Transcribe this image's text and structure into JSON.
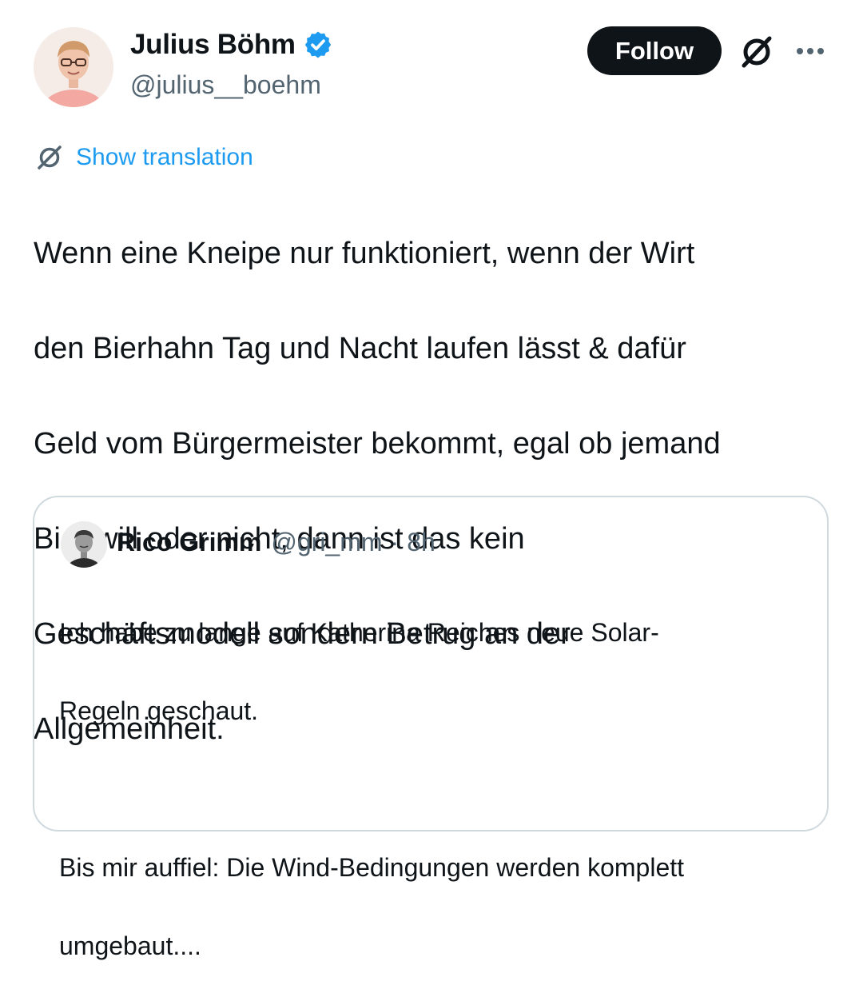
{
  "post": {
    "author_name": "Julius Böhm",
    "author_handle": "@julius__boehm",
    "follow_label": "Follow",
    "translate_label": "Show translation",
    "text_lines": [
      "Wenn eine Kneipe nur funktioniert, wenn der Wirt",
      "den Bierhahn Tag und Nacht laufen lässt & dafür",
      "Geld vom Bürgermeister bekommt, egal ob jemand",
      "Bier will oder nicht, dann ist das kein",
      "Geschäftsmodell sondern Betrug an der",
      "Allgemeinheit."
    ]
  },
  "quote": {
    "author_name": "Rico Grimm",
    "author_handle": "@gri_mm",
    "separator": "·",
    "time": "8h",
    "text_lines": [
      "Ich habe zu lange auf Katherina Reiches neue Solar-",
      "Regeln geschaut.",
      "",
      "Bis mir auffiel: Die Wind-Bedingungen werden komplett",
      "umgebaut...."
    ]
  },
  "icons": {
    "verified": "verified-badge-icon",
    "grok": "grok-icon",
    "more": "more-dots-icon",
    "translate": "grok-translate-icon"
  },
  "colors": {
    "link_blue": "#1d9bf0",
    "verified_blue": "#1d9bf0",
    "text": "#0f1419",
    "secondary": "#536471",
    "border": "#cfd9de",
    "follow_bg": "#0f1419"
  }
}
